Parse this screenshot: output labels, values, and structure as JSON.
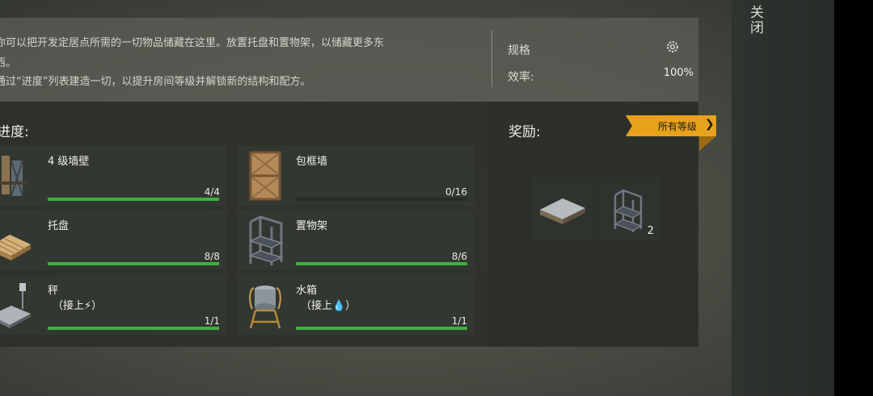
{
  "close": {
    "label": "关闭"
  },
  "info": {
    "description": [
      "你可以把开发定居点所需的一切物品储藏在这里。放置托盘和置物架，以储藏更多东",
      "西。",
      "通过“进度”列表建造一切，以提升房间等级并解锁新的结构和配方。"
    ],
    "spec_label": "规格",
    "spec_icon": "gear-icon",
    "efficiency_label": "效率:",
    "efficiency_value": "100%"
  },
  "progress": {
    "title": "进度:",
    "items": [
      {
        "name": "4 级墙壁",
        "sub": "",
        "count": "4/4",
        "progress": 1.0,
        "icon": "wall-icon"
      },
      {
        "name": "包框墙",
        "sub": "",
        "count": "0/16",
        "progress": 0.0,
        "icon": "framed-wall-icon"
      },
      {
        "name": "托盘",
        "sub": "",
        "count": "8/8",
        "progress": 1.0,
        "icon": "pallet-icon"
      },
      {
        "name": "置物架",
        "sub": "",
        "count": "8/6",
        "progress": 1.0,
        "icon": "shelf-icon"
      },
      {
        "name": "秤",
        "sub": "（接上⚡）",
        "count": "1/1",
        "progress": 1.0,
        "icon": "scale-icon"
      },
      {
        "name": "水箱",
        "sub": "（接上💧）",
        "count": "1/1",
        "progress": 1.0,
        "icon": "water-tank-icon"
      }
    ]
  },
  "rewards": {
    "title": "奖励:",
    "all_levels": "所有等级",
    "items": [
      {
        "icon": "pallet-reward-icon",
        "qty": ""
      },
      {
        "icon": "shelf-reward-icon",
        "qty": "2"
      }
    ]
  },
  "colors": {
    "progress_green": "#3db13a",
    "tag_orange": "#e8a21c"
  }
}
